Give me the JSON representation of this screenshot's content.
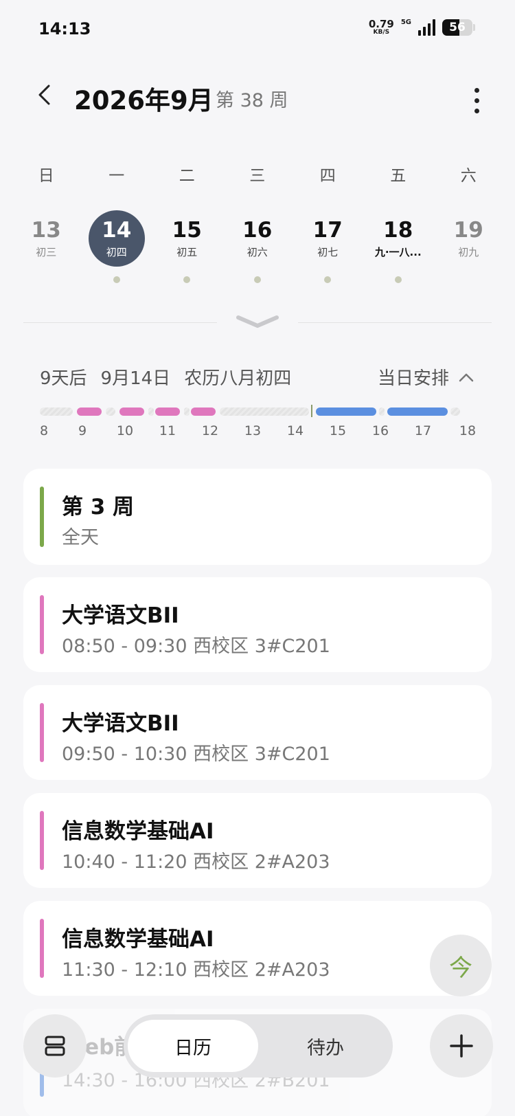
{
  "status_bar": {
    "time": "14:13",
    "net_speed": "0.79",
    "net_unit": "KB/S",
    "network": "5G",
    "battery": "56"
  },
  "header": {
    "title": "2026年9月",
    "week": "第 38 周"
  },
  "weekdays": [
    "日",
    "一",
    "二",
    "三",
    "四",
    "五",
    "六"
  ],
  "days": [
    {
      "num": "13",
      "lunar": "初三"
    },
    {
      "num": "14",
      "lunar": "初四"
    },
    {
      "num": "15",
      "lunar": "初五"
    },
    {
      "num": "16",
      "lunar": "初六"
    },
    {
      "num": "17",
      "lunar": "初七"
    },
    {
      "num": "18",
      "lunar": "九·一八..."
    },
    {
      "num": "19",
      "lunar": "初九"
    }
  ],
  "summary": {
    "relative": "9天后",
    "date": "9月14日",
    "lunar": "农历八月初四",
    "arrange_label": "当日安排"
  },
  "timeline": {
    "hours": [
      "8",
      "9",
      "10",
      "11",
      "12",
      "13",
      "14",
      "15",
      "16",
      "17",
      "18"
    ]
  },
  "events": [
    {
      "title": "第 3 周",
      "time": "全天",
      "color": "#7ca84a"
    },
    {
      "title": "大学语文BII",
      "time": "08:50 - 09:30  西校区 3#C201",
      "color": "#df77bd"
    },
    {
      "title": "大学语文BII",
      "time": "09:50 - 10:30  西校区 3#C201",
      "color": "#df77bd"
    },
    {
      "title": "信息数学基础AI",
      "time": "10:40 - 11:20  西校区 2#A203",
      "color": "#df77bd"
    },
    {
      "title": "信息数学基础AI",
      "time": "11:30 - 12:10  西校区 2#A203",
      "color": "#df77bd"
    },
    {
      "title": "Web前",
      "time": "14:30 - 16:00  西校区 2#B201",
      "color": "#5b8fe0"
    }
  ],
  "bottom": {
    "today_label": "今",
    "tab_calendar": "日历",
    "tab_todo": "待办"
  },
  "icons": {
    "back": "chevron-left-icon",
    "more": "more-vertical-icon",
    "expand": "chevron-down-icon",
    "collapse": "chevron-up-icon",
    "view": "view-toggle-icon",
    "add": "plus-icon"
  }
}
